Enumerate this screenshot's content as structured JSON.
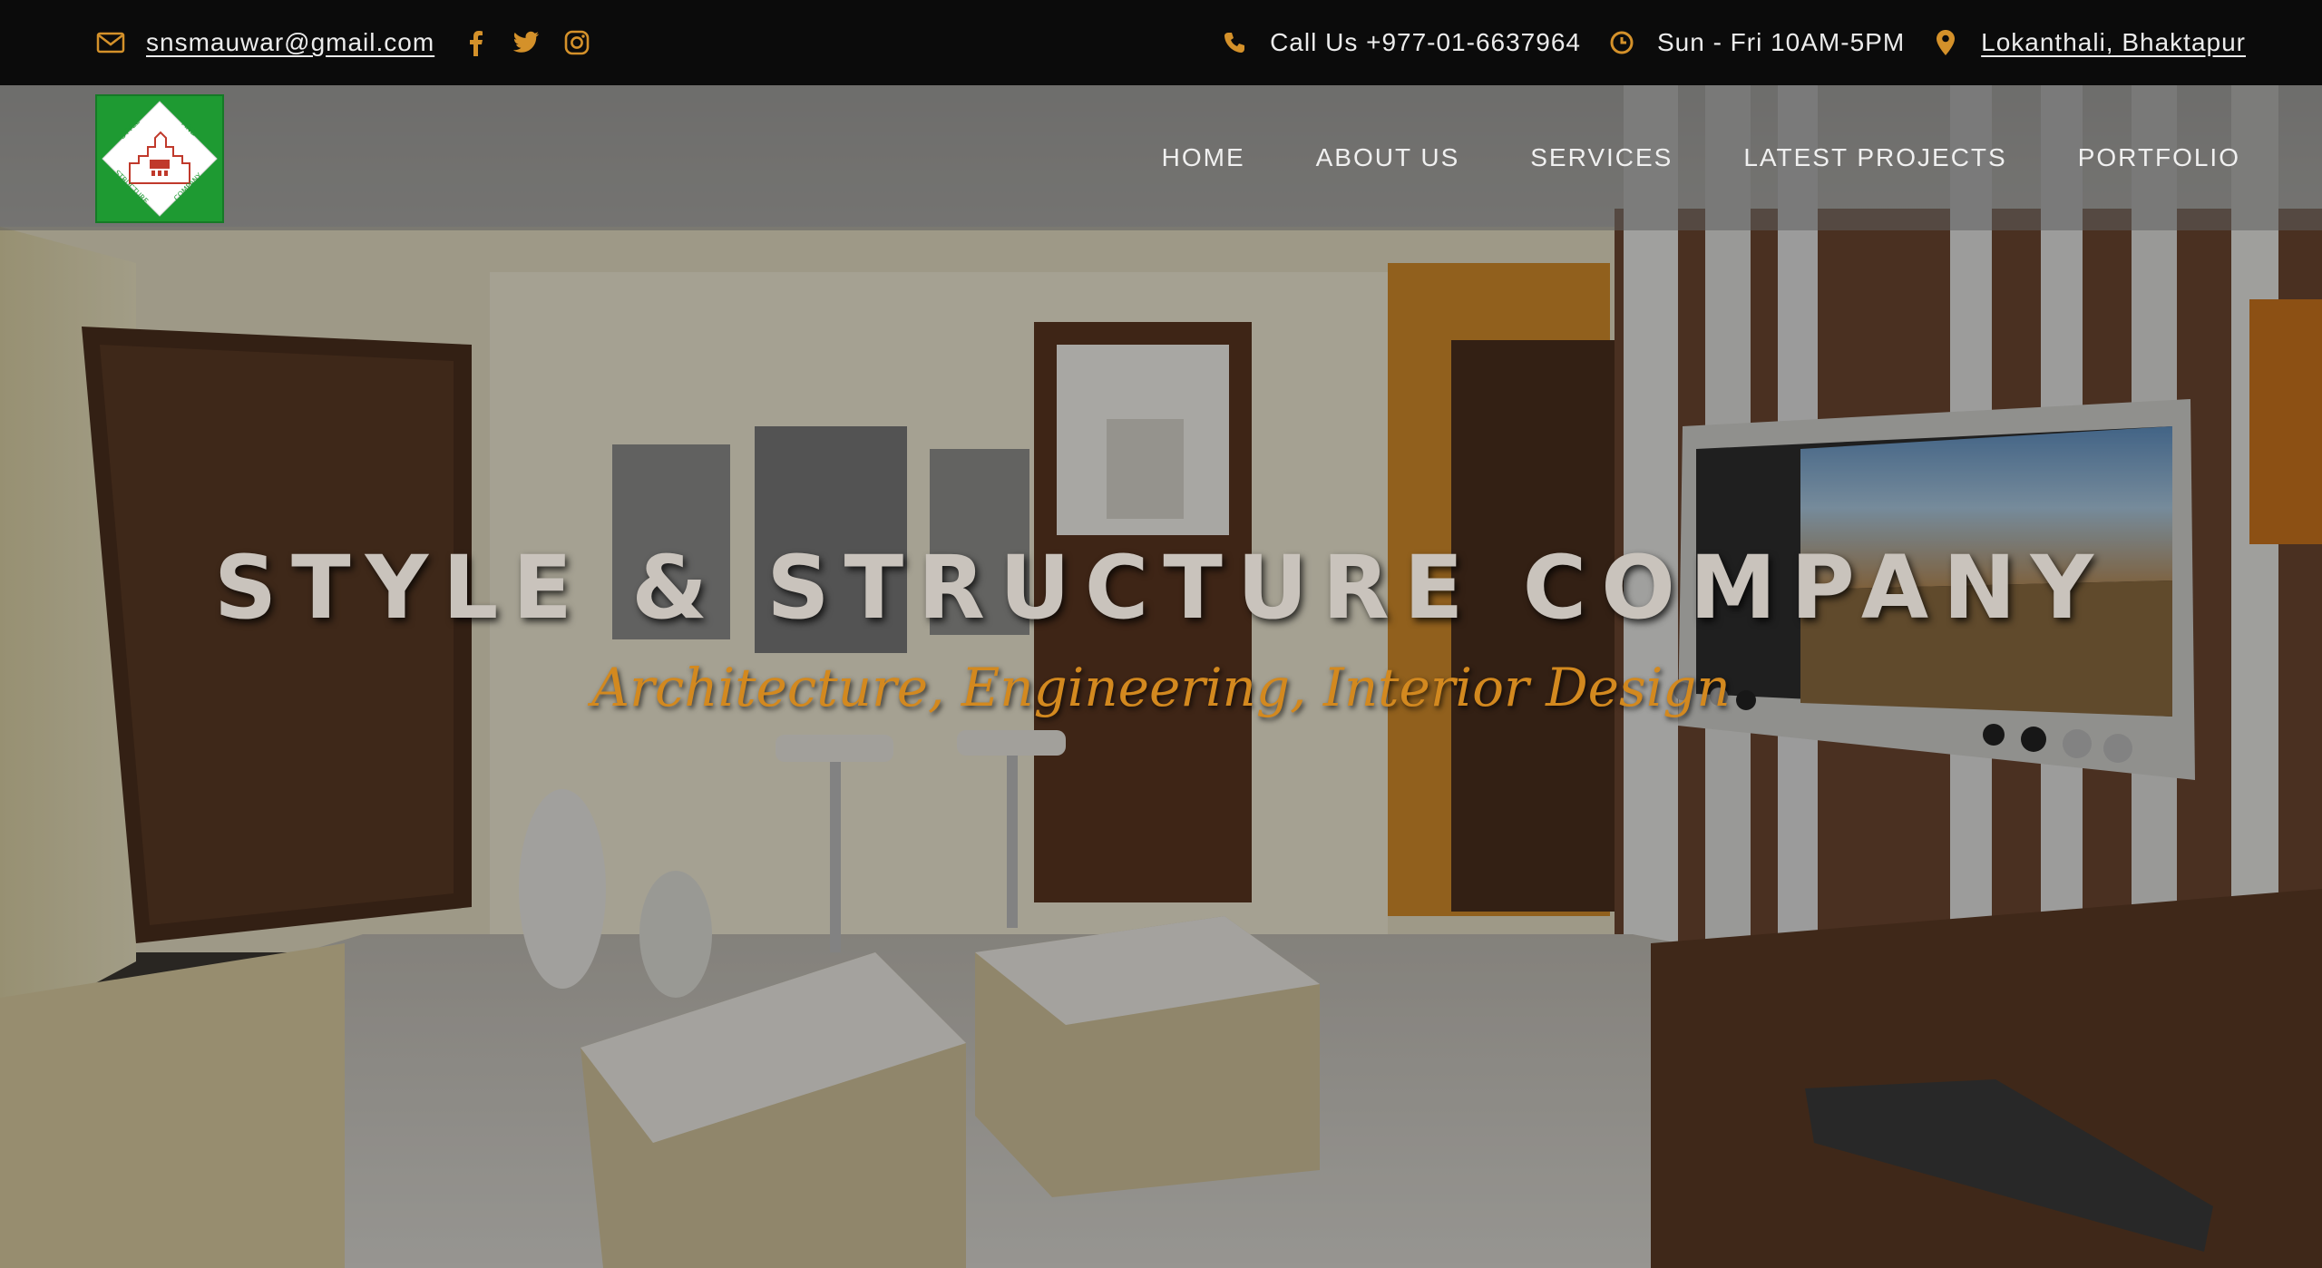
{
  "topbar": {
    "email": "snsmauwar@gmail.com",
    "phone": "Call Us +977-01-6637964",
    "hours": "Sun - Fri 10AM-5PM",
    "location": "Lokanthali, Bhaktapur",
    "icons": [
      "envelope-icon",
      "facebook-icon",
      "twitter-icon",
      "instagram-icon",
      "phone-icon",
      "clock-icon",
      "map-pin-icon"
    ],
    "accent_color": "#d4912a"
  },
  "logo": {
    "top_left": "STYLE",
    "top_right": "AND",
    "bottom_left": "STRUCTURE",
    "bottom_right": "COMPANY",
    "colors": {
      "background": "#1e9a32",
      "diamond": "#ffffff",
      "building": "#c0392b"
    }
  },
  "nav": {
    "items": [
      "HOME",
      "ABOUT US",
      "SERVICES",
      "LATEST PROJECTS",
      "PORTFOLIO"
    ]
  },
  "hero": {
    "title": "STYLE & STRUCTURE COMPANY",
    "subtitle": "Architecture, Engineering, Interior Design",
    "subtitle_color": "#d3891f"
  }
}
